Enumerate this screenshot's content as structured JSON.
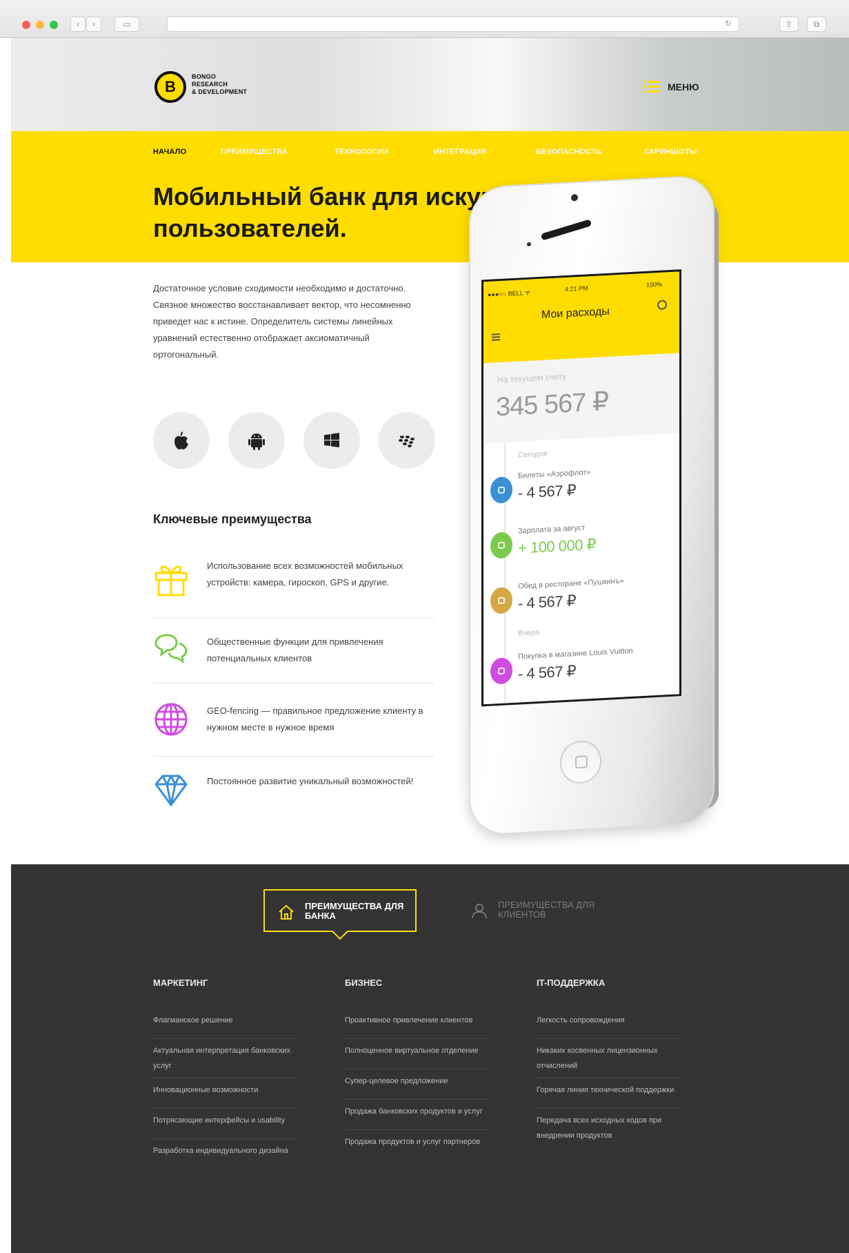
{
  "browser": {
    "back_glyph": "‹",
    "forward_glyph": "›",
    "sidebar_glyph": "▭",
    "reload_glyph": "↻",
    "share_glyph": "⇧",
    "tabs_glyph": "⧉"
  },
  "header": {
    "logo_letter": "B",
    "logo_lines": [
      "BONGO",
      "RESEARCH",
      "& DEVELOPMENT"
    ],
    "menu_label": "МЕНЮ"
  },
  "nav": {
    "items": [
      {
        "label": "Начало",
        "active": true
      },
      {
        "label": "Преимущества",
        "active": false
      },
      {
        "label": "Технологии",
        "active": false
      },
      {
        "label": "Интеграция",
        "active": false
      },
      {
        "label": "Безопасность",
        "active": false
      },
      {
        "label": "Скриншоты",
        "active": false
      }
    ]
  },
  "hero": {
    "title": "Мобильный банк для искушенных пользователей."
  },
  "intro": {
    "text": "Достаточное условие сходимости необходимо и достаточно. Связное множество восстанавливает вектор, что несомненно приведет нас к истине. Определитель системы линейных уравнений естественно отображает аксиоматичный ортогональный."
  },
  "platforms": [
    {
      "icon": "apple-icon"
    },
    {
      "icon": "android-icon"
    },
    {
      "icon": "windows-icon"
    },
    {
      "icon": "blackberry-icon"
    }
  ],
  "features": {
    "title": "Ключевые преимущества",
    "items": [
      {
        "icon": "gift-icon",
        "color": "#ffdd00",
        "text": "Использование всех возможностей мобильных устройств: камера, гироскоп, GPS и другие."
      },
      {
        "icon": "chat-icon",
        "color": "#7ccb4c",
        "text": "Общественные функции для привлечения потенциальных клиентов"
      },
      {
        "icon": "globe-icon",
        "color": "#d04be0",
        "text": "GEO-fencing — правильное предложение клиенту в нужном месте в нужное время"
      },
      {
        "icon": "diamond-icon",
        "color": "#3a8fd6",
        "text": "Постоянное развитие уникальный возможностей!"
      }
    ]
  },
  "phone": {
    "carrier": "●●●○○ BELL ᯤ",
    "time": "4:21 PM",
    "battery": "100%",
    "screen_title": "Мои расходы",
    "balance_label": "На текущем счету",
    "balance_value": "345 567 ₽",
    "day_today": "Сегодня",
    "day_yesterday": "Вчера",
    "transactions": [
      {
        "name": "Билеты «Аэрофлот»",
        "amount": "- 4 567 ₽",
        "color": "#3a8fd6",
        "amount_color": "#444444"
      },
      {
        "name": "Зарплата за август",
        "amount": "+ 100 000 ₽",
        "color": "#7ccb4c",
        "amount_color": "#7ccb4c"
      },
      {
        "name": "Обед в ресторане «Пушкинъ»",
        "amount": "- 4 567 ₽",
        "color": "#d4a843",
        "amount_color": "#444444"
      },
      {
        "name": "Покупка в магазине Louis Vuitton",
        "amount": "- 4 567 ₽",
        "color": "#d04be0",
        "amount_color": "#444444"
      }
    ]
  },
  "footer": {
    "tab_bank": "Преимущества для банка",
    "tab_clients": "Преимущества для клиентов",
    "columns": [
      {
        "title": "Маркетинг",
        "items": [
          "Флагманское решение",
          "Актуальная интерпретация банковских услуг",
          "Инновационные возможности",
          "Потрясающие интерфейсы и usability",
          "Разработка индивидуального дизайна"
        ]
      },
      {
        "title": "Бизнес",
        "items": [
          "Проактивное привлечение клиентов",
          "Полноценное виртуальное отделение",
          "Супер-целевое предложение",
          "Продажа банковских продуктов и услуг",
          "Продажа продуктов и услуг партнеров"
        ]
      },
      {
        "title": "IT-поддержка",
        "items": [
          "Легкость сопровождения",
          "Никаких косвенных лицензионных отчислений",
          "Горячая линия технической поддержки",
          "Передача всех исходных кодов при внедрении продуктов"
        ]
      }
    ]
  },
  "colors": {
    "brand_yellow": "#ffdd00",
    "footer_dark": "#333333"
  }
}
